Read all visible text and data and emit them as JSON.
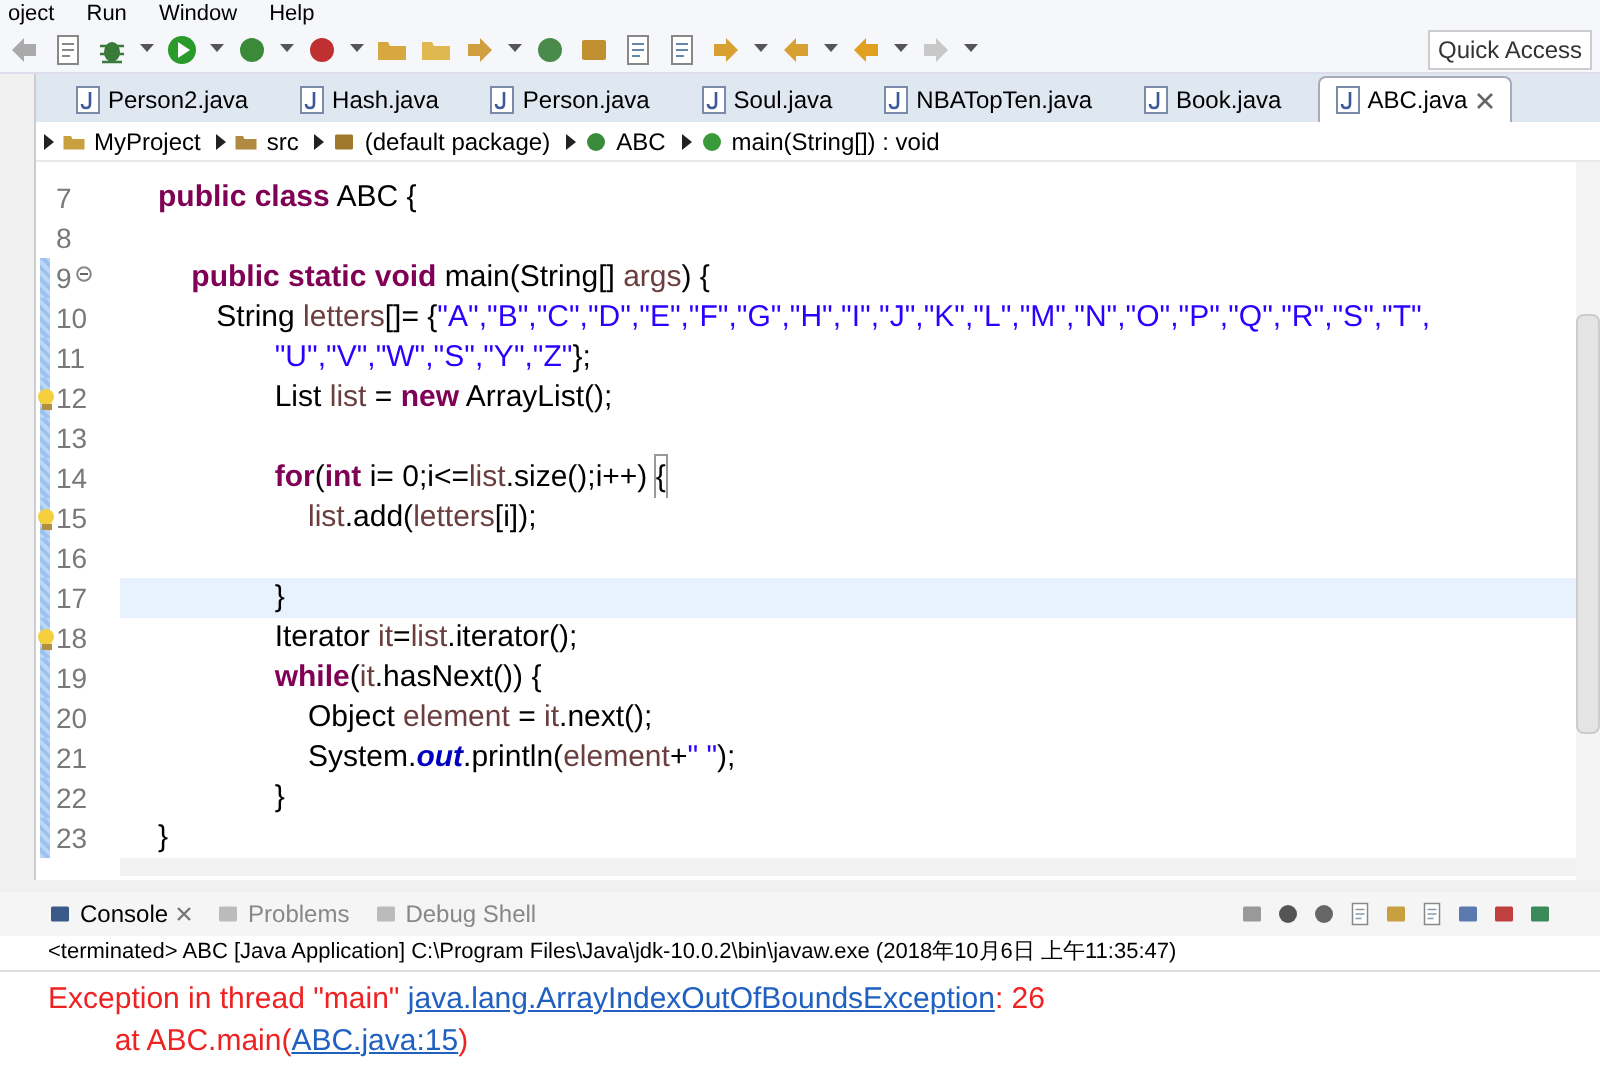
{
  "menu": [
    "oject",
    "Run",
    "Window",
    "Help"
  ],
  "quick_access": {
    "placeholder": "Quick Access"
  },
  "tabs": [
    {
      "label": "Person2.java",
      "selected": false
    },
    {
      "label": "Hash.java",
      "selected": false
    },
    {
      "label": "Person.java",
      "selected": false
    },
    {
      "label": "Soul.java",
      "selected": false
    },
    {
      "label": "NBATopTen.java",
      "selected": false
    },
    {
      "label": "Book.java",
      "selected": false
    },
    {
      "label": "ABC.java",
      "selected": true
    }
  ],
  "breadcrumb": [
    {
      "kind": "project",
      "label": "MyProject"
    },
    {
      "kind": "folder",
      "label": "src"
    },
    {
      "kind": "package",
      "label": "(default package)"
    },
    {
      "kind": "class",
      "label": "ABC"
    },
    {
      "kind": "method",
      "label": "main(String[]) : void"
    }
  ],
  "code": [
    {
      "number": "7",
      "foldable": false,
      "warning": false,
      "current": false,
      "tokens": [
        {
          "kind": "kw",
          "text": "public class"
        },
        {
          "kind": "plain",
          "text": " ABC {"
        }
      ]
    },
    {
      "number": "8",
      "foldable": false,
      "warning": false,
      "current": false
    },
    {
      "number": "9",
      "foldable": true,
      "warning": false,
      "current": false,
      "tokens": [
        {
          "kind": "kw",
          "text": "    public static void"
        },
        {
          "kind": "plain",
          "text": " main(String[] "
        },
        {
          "kind": "var",
          "text": "args"
        },
        {
          "kind": "plain",
          "text": ") {"
        }
      ]
    },
    {
      "number": "10",
      "foldable": false,
      "warning": false,
      "current": false,
      "tokens": [
        {
          "kind": "plain",
          "text": "       String "
        },
        {
          "kind": "var",
          "text": "letters"
        },
        {
          "kind": "plain",
          "text": "[]= {"
        },
        {
          "kind": "str",
          "text": "\"A\",\"B\",\"C\",\"D\",\"E\",\"F\",\"G\",\"H\",\"I\",\"J\",\"K\",\"L\",\"M\",\"N\",\"O\",\"P\",\"Q\",\"R\",\"S\",\"T\","
        }
      ]
    },
    {
      "number": "11",
      "foldable": false,
      "warning": false,
      "current": false,
      "tokens": [
        {
          "kind": "str",
          "text": "              \"U\",\"V\",\"W\",\"S\",\"Y\",\"Z\""
        },
        {
          "kind": "plain",
          "text": "};"
        }
      ]
    },
    {
      "number": "12",
      "foldable": false,
      "warning": true,
      "current": false,
      "tokens": [
        {
          "kind": "plain",
          "text": "              List "
        },
        {
          "kind": "var",
          "text": "list"
        },
        {
          "kind": "plain",
          "text": " = "
        },
        {
          "kind": "kw",
          "text": "new"
        },
        {
          "kind": "plain",
          "text": " ArrayList();"
        }
      ]
    },
    {
      "number": "13",
      "foldable": false,
      "warning": false,
      "current": false
    },
    {
      "number": "14",
      "foldable": false,
      "warning": false,
      "current": false,
      "tokens": [
        {
          "kind": "kw",
          "text": "              for"
        },
        {
          "kind": "plain",
          "text": "("
        },
        {
          "kind": "kw",
          "text": "int"
        },
        {
          "kind": "plain",
          "text": " i= 0;i<="
        },
        {
          "kind": "var",
          "text": "list"
        },
        {
          "kind": "plain",
          "text": ".size();i++) "
        },
        {
          "kind": "match",
          "text": "{"
        }
      ]
    },
    {
      "number": "15",
      "foldable": false,
      "warning": true,
      "current": false,
      "tokens": [
        {
          "kind": "var",
          "text": "                  list"
        },
        {
          "kind": "plain",
          "text": ".add("
        },
        {
          "kind": "var",
          "text": "letters"
        },
        {
          "kind": "plain",
          "text": "[i]);"
        }
      ]
    },
    {
      "number": "16",
      "foldable": false,
      "warning": false,
      "current": false
    },
    {
      "number": "17",
      "foldable": false,
      "warning": false,
      "current": true,
      "tokens": [
        {
          "kind": "plain",
          "text": "              }"
        }
      ]
    },
    {
      "number": "18",
      "foldable": false,
      "warning": true,
      "current": false,
      "tokens": [
        {
          "kind": "plain",
          "text": "              Iterator "
        },
        {
          "kind": "var",
          "text": "it"
        },
        {
          "kind": "plain",
          "text": "="
        },
        {
          "kind": "var",
          "text": "list"
        },
        {
          "kind": "plain",
          "text": ".iterator();"
        }
      ]
    },
    {
      "number": "19",
      "foldable": false,
      "warning": false,
      "current": false,
      "tokens": [
        {
          "kind": "kw",
          "text": "              while"
        },
        {
          "kind": "plain",
          "text": "("
        },
        {
          "kind": "var",
          "text": "it"
        },
        {
          "kind": "plain",
          "text": ".hasNext()) {"
        }
      ]
    },
    {
      "number": "20",
      "foldable": false,
      "warning": false,
      "current": false,
      "tokens": [
        {
          "kind": "plain",
          "text": "                  Object "
        },
        {
          "kind": "var",
          "text": "element"
        },
        {
          "kind": "plain",
          "text": " = "
        },
        {
          "kind": "var",
          "text": "it"
        },
        {
          "kind": "plain",
          "text": ".next();"
        }
      ]
    },
    {
      "number": "21",
      "foldable": false,
      "warning": false,
      "current": false,
      "tokens": [
        {
          "kind": "plain",
          "text": "                  System."
        },
        {
          "kind": "field",
          "text": "out"
        },
        {
          "kind": "plain",
          "text": ".println("
        },
        {
          "kind": "var",
          "text": "element"
        },
        {
          "kind": "plain",
          "text": "+"
        },
        {
          "kind": "str",
          "text": "\" \""
        },
        {
          "kind": "plain",
          "text": ");"
        }
      ]
    },
    {
      "number": "22",
      "foldable": false,
      "warning": false,
      "current": false,
      "tokens": [
        {
          "kind": "plain",
          "text": "              }"
        }
      ]
    },
    {
      "number": "23",
      "foldable": false,
      "warning": false,
      "current": false,
      "tokens": [
        {
          "kind": "plain",
          "text": "}"
        }
      ]
    }
  ],
  "console_tabs": [
    {
      "label": "Console",
      "selected": true
    },
    {
      "label": "Problems",
      "selected": false
    },
    {
      "label": "Debug Shell",
      "selected": false
    }
  ],
  "console_status": "<terminated> ABC [Java Application] C:\\Program Files\\Java\\jdk-10.0.2\\bin\\javaw.exe (2018年10月6日 上午11:35:47)",
  "console_output": [
    {
      "parts": [
        {
          "kind": "error",
          "text": "Exception in thread \"main\" "
        },
        {
          "kind": "link",
          "text": "java.lang.ArrayIndexOutOfBoundsException"
        },
        {
          "kind": "error",
          "text": ": 26"
        }
      ]
    },
    {
      "parts": [
        {
          "kind": "error",
          "text": "        at ABC.main("
        },
        {
          "kind": "link",
          "text": "ABC.java:15"
        },
        {
          "kind": "error",
          "text": ")"
        }
      ]
    }
  ]
}
